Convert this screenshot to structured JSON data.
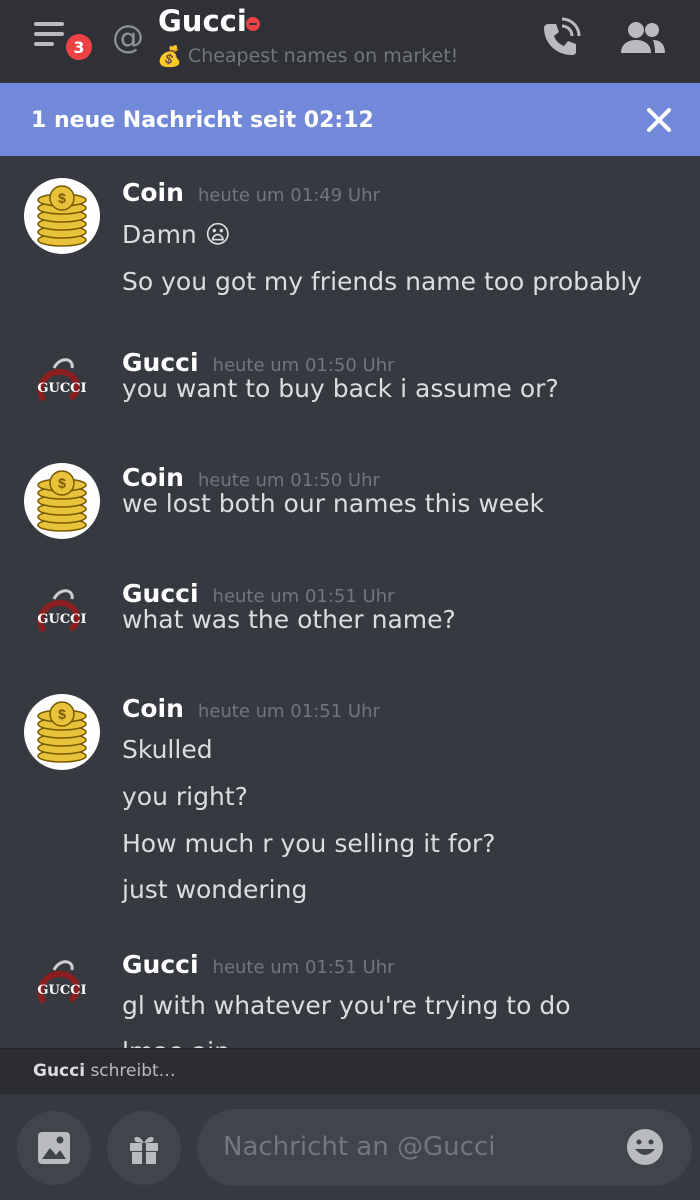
{
  "header": {
    "notification_count": "3",
    "at_symbol": "@",
    "channel_name": "Gucci",
    "status_emoji": "💰",
    "status_text": "Cheapest names on market!",
    "icons": [
      "menu-icon",
      "at-icon",
      "dnd-status-icon",
      "phone-call-icon",
      "members-icon"
    ]
  },
  "banner": {
    "text": "1 neue Nachricht seit 02:12",
    "close_icon": "close-icon"
  },
  "messages": [
    {
      "author": "Coin",
      "timestamp": "heute um 01:49 Uhr",
      "lines": [
        "Damn 😦",
        "So you got my friends name too probably"
      ]
    },
    {
      "author": "Gucci",
      "timestamp": "heute um 01:50 Uhr",
      "lines": [
        "you want to buy back i assume or?"
      ]
    },
    {
      "author": "Coin",
      "timestamp": "heute um 01:50 Uhr",
      "lines": [
        "we lost both our names this week"
      ]
    },
    {
      "author": "Gucci",
      "timestamp": "heute um 01:51 Uhr",
      "lines": [
        "what was the other name?"
      ]
    },
    {
      "author": "Coin",
      "timestamp": "heute um 01:51 Uhr",
      "lines": [
        "Skulled",
        "you right?",
        "How much r you selling it for?",
        "just wondering"
      ]
    },
    {
      "author": "Gucci",
      "timestamp": "heute um 01:51 Uhr",
      "lines": [
        "gl with whatever you're trying to do",
        "lmao ain"
      ]
    }
  ],
  "avatars": {
    "gucci_text": "GUCCI"
  },
  "typing": {
    "name": "Gucci",
    "text": " schreibt…"
  },
  "composer": {
    "placeholder": "Nachricht an @Gucci",
    "icons": [
      "image-icon",
      "gift-icon",
      "emoji-icon"
    ]
  },
  "colors": {
    "background": "#36393f",
    "header": "#2f3136",
    "banner": "#7289da",
    "badge": "#ed4245",
    "muted": "#72767d"
  }
}
